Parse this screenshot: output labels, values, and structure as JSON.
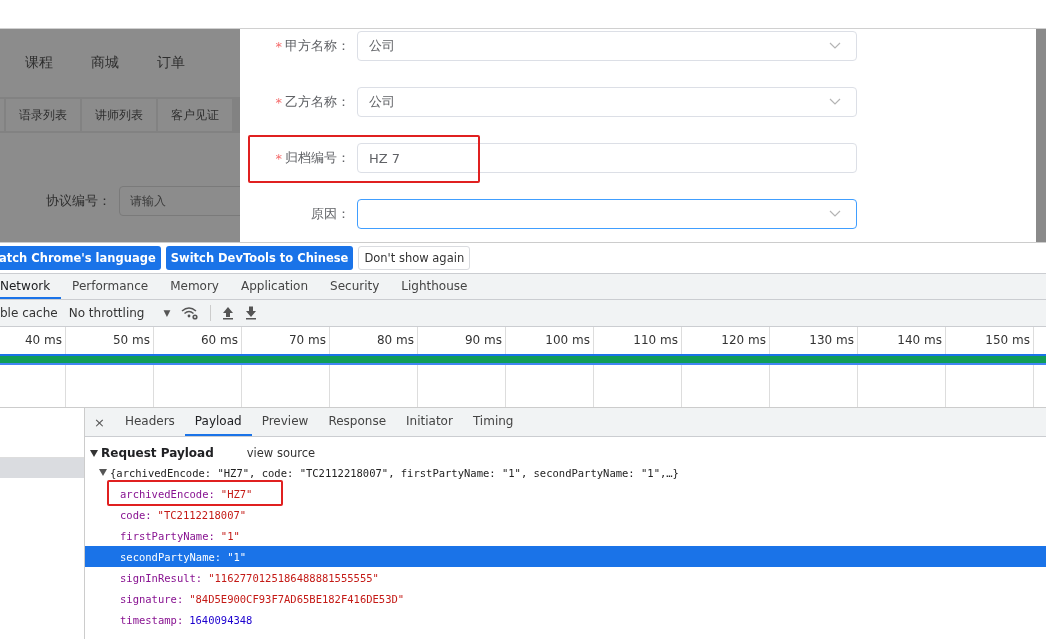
{
  "background_page": {
    "nav": [
      "课程",
      "商城",
      "订单"
    ],
    "tabs": [
      "语录列表",
      "讲师列表",
      "客户见证"
    ],
    "filter": {
      "label": "协议编号：",
      "placeholder": "请输入"
    }
  },
  "dialog": {
    "required_mark": "*",
    "fields": [
      {
        "label": "甲方名称：",
        "required": true,
        "kind": "select",
        "value": "公司",
        "focused": false,
        "highlighted": false
      },
      {
        "label": "乙方名称：",
        "required": true,
        "kind": "select",
        "value": "公司",
        "focused": false,
        "highlighted": false
      },
      {
        "label": "归档编号：",
        "required": true,
        "kind": "input",
        "value": "HZ 7",
        "focused": false,
        "highlighted": true
      },
      {
        "label": "原因：",
        "required": false,
        "kind": "select",
        "focused": true,
        "highlighted": false
      }
    ]
  },
  "devtools": {
    "infobar_buttons": [
      {
        "label": "atch Chrome's language",
        "kind": "primary"
      },
      {
        "label": "Switch DevTools to Chinese",
        "kind": "primary"
      },
      {
        "label": "Don't show again",
        "kind": "plain"
      }
    ],
    "panel_tabs": [
      {
        "label": "Network",
        "selected": true
      },
      {
        "label": "Performance",
        "selected": false
      },
      {
        "label": "Memory",
        "selected": false
      },
      {
        "label": "Application",
        "selected": false
      },
      {
        "label": "Security",
        "selected": false
      },
      {
        "label": "Lighthouse",
        "selected": false
      }
    ],
    "toolbar": {
      "cache_label": "ble cache",
      "throttling": "No throttling",
      "dropdown": "▼"
    },
    "timeline": {
      "ticks": [
        "40 ms",
        "50 ms",
        "60 ms",
        "70 ms",
        "80 ms",
        "90 ms",
        "100 ms",
        "110 ms",
        "120 ms",
        "130 ms",
        "140 ms",
        "150 ms"
      ]
    },
    "request_rows": [
      {
        "selected": true
      }
    ],
    "detail_close": "×",
    "detail_tabs": [
      {
        "label": "Headers",
        "selected": false
      },
      {
        "label": "Payload",
        "selected": true
      },
      {
        "label": "Preview",
        "selected": false
      },
      {
        "label": "Response",
        "selected": false
      },
      {
        "label": "Initiator",
        "selected": false
      },
      {
        "label": "Timing",
        "selected": false
      }
    ],
    "payload": {
      "title": "Request Payload",
      "view_source": "view source",
      "summary": "{archivedEncode: \"HZ7\", code: \"TC2112218007\", firstPartyName: \"1\", secondPartyName: \"1\",…}",
      "properties": [
        {
          "key": "archivedEncode:",
          "value": "\"HZ7\"",
          "kind": "string",
          "selected": false,
          "highlighted": true
        },
        {
          "key": "code:",
          "value": "\"TC2112218007\"",
          "kind": "string",
          "selected": false,
          "highlighted": false
        },
        {
          "key": "firstPartyName:",
          "value": "\"1\"",
          "kind": "string",
          "selected": false,
          "highlighted": false
        },
        {
          "key": "secondPartyName:",
          "value": "\"1\"",
          "kind": "string",
          "selected": true,
          "highlighted": false
        },
        {
          "key": "signInResult:",
          "value": "\"1162770125186488881555555\"",
          "kind": "string",
          "selected": false,
          "highlighted": false
        },
        {
          "key": "signature:",
          "value": "\"84D5E900CF93F7AD65BE182F416DE53D\"",
          "kind": "string",
          "selected": false,
          "highlighted": false
        },
        {
          "key": "timestamp:",
          "value": "1640094348",
          "kind": "number",
          "selected": false,
          "highlighted": false
        }
      ]
    }
  }
}
